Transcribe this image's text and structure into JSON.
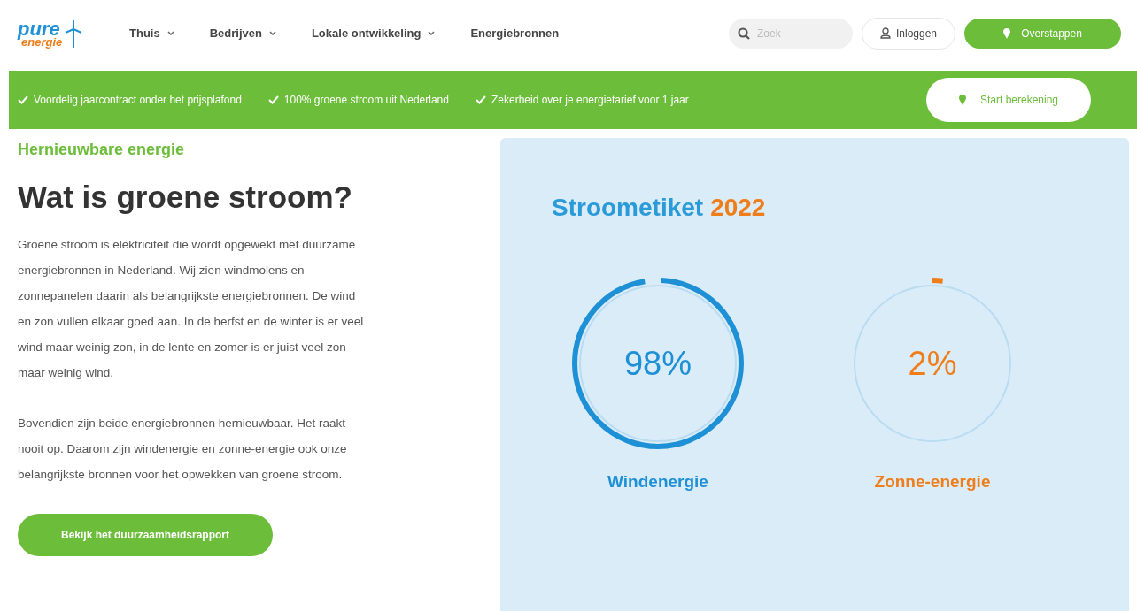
{
  "logo": {
    "top": "pure",
    "bottom": "energie"
  },
  "nav": [
    {
      "label": "Thuis",
      "dropdown": true
    },
    {
      "label": "Bedrijven",
      "dropdown": true
    },
    {
      "label": "Lokale ontwikkeling",
      "dropdown": true
    },
    {
      "label": "Energiebronnen",
      "dropdown": false
    }
  ],
  "search": {
    "placeholder": "Zoek"
  },
  "login_button": "Inloggen",
  "switch_button": "Overstappen",
  "usps": [
    "Voordelig jaarcontract onder het prijsplafond",
    "100% groene stroom uit Nederland",
    "Zekerheid over je energietarief voor 1 jaar"
  ],
  "calc_button": "Start berekening",
  "eyebrow": "Hernieuwbare energie",
  "heading": "Wat is groene stroom?",
  "paragraphs": [
    "Groene stroom is elektriciteit die wordt opgewekt met duurzame energiebronnen in Nederland. Wij zien windmolens en zonnepanelen daarin als belangrijkste energiebronnen. De wind en zon vullen elkaar goed aan. In de herfst en de winter is er veel wind maar weinig zon, in de lente en zomer is er juist veel zon maar weinig wind.",
    "Bovendien zijn beide energiebronnen hernieuwbaar. Het raakt nooit op. Daarom zijn windenergie en zonne-energie ook onze belangrijkste bronnen voor het opwekken van groene stroom."
  ],
  "report_button": "Bekijk het duurzaamheidsrapport",
  "label_card": {
    "title": "Stroometiket",
    "year": "2022",
    "gauges": [
      {
        "value": "98%",
        "name": "Windenergie",
        "level": 0.98,
        "color": "#1e90d6"
      },
      {
        "value": "2%",
        "name": "Zonne-energie",
        "level": 0.02,
        "color": "#ef7d1a"
      }
    ]
  }
}
